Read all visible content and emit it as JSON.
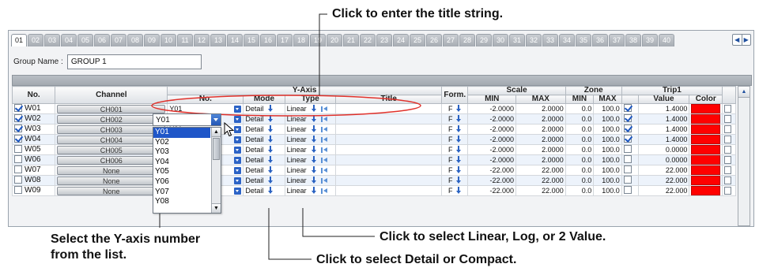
{
  "callouts": {
    "title": "Click to enter the title string.",
    "yaxis": [
      "Select the Y-axis number",
      "from the list."
    ],
    "type": "Click to select Linear, Log, or 2 Value.",
    "mode": "Click to select Detail or Compact."
  },
  "tabs": [
    "01",
    "02",
    "03",
    "04",
    "05",
    "06",
    "07",
    "08",
    "09",
    "10",
    "11",
    "12",
    "13",
    "14",
    "15",
    "16",
    "17",
    "18",
    "19",
    "20",
    "21",
    "22",
    "23",
    "24",
    "25",
    "26",
    "27",
    "28",
    "29",
    "30",
    "31",
    "32",
    "33",
    "34",
    "35",
    "36",
    "37",
    "38",
    "39",
    "40"
  ],
  "tab_nav": {
    "prev": "◀",
    "next": "▶"
  },
  "group": {
    "label": "Group Name :",
    "value": "GROUP 1"
  },
  "headers": {
    "no": "No.",
    "channel": "Channel",
    "yaxis": "Y-Axis",
    "ya_no": "No.",
    "mode": "Mode",
    "type": "Type",
    "title": "Title",
    "form": "Form.",
    "scale": "Scale",
    "min": "MIN",
    "max": "MAX",
    "zone": "Zone",
    "trip": "Trip1",
    "value": "Value",
    "color": "Color"
  },
  "rows": [
    {
      "no": "W01",
      "checked": true,
      "channel": "CH001",
      "y": "Y01",
      "mode": "Detail",
      "type": "Linear",
      "form": "F",
      "min": "-2.0000",
      "max": "2.0000",
      "zmin": "0.0",
      "zmax": "100.0",
      "trip_on": true,
      "trip": "1.4000"
    },
    {
      "no": "W02",
      "checked": true,
      "channel": "CH002",
      "y": "Y01",
      "mode": "Detail",
      "type": "Linear",
      "form": "F",
      "min": "-2.0000",
      "max": "2.0000",
      "zmin": "0.0",
      "zmax": "100.0",
      "trip_on": true,
      "trip": "1.4000"
    },
    {
      "no": "W03",
      "checked": true,
      "channel": "CH003",
      "y": "Y01",
      "mode": "Detail",
      "type": "Linear",
      "form": "F",
      "min": "-2.0000",
      "max": "2.0000",
      "zmin": "0.0",
      "zmax": "100.0",
      "trip_on": true,
      "trip": "1.4000"
    },
    {
      "no": "W04",
      "checked": true,
      "channel": "CH004",
      "y": "Y01",
      "mode": "Detail",
      "type": "Linear",
      "form": "F",
      "min": "-2.0000",
      "max": "2.0000",
      "zmin": "0.0",
      "zmax": "100.0",
      "trip_on": true,
      "trip": "1.4000"
    },
    {
      "no": "W05",
      "checked": false,
      "channel": "CH005",
      "y": "Y01",
      "mode": "Detail",
      "type": "Linear",
      "form": "F",
      "min": "-2.0000",
      "max": "2.0000",
      "zmin": "0.0",
      "zmax": "100.0",
      "trip_on": false,
      "trip": "0.0000"
    },
    {
      "no": "W06",
      "checked": false,
      "channel": "CH006",
      "y": "Y01",
      "mode": "Detail",
      "type": "Linear",
      "form": "F",
      "min": "-2.0000",
      "max": "2.0000",
      "zmin": "0.0",
      "zmax": "100.0",
      "trip_on": false,
      "trip": "0.0000"
    },
    {
      "no": "W07",
      "checked": false,
      "channel": "None",
      "y": "Y01",
      "mode": "Detail",
      "type": "Linear",
      "form": "F",
      "min": "-22.000",
      "max": "22.000",
      "zmin": "0.0",
      "zmax": "100.0",
      "trip_on": false,
      "trip": "22.000"
    },
    {
      "no": "W08",
      "checked": false,
      "channel": "None",
      "y": "Y01",
      "mode": "Detail",
      "type": "Linear",
      "form": "F",
      "min": "-22.000",
      "max": "22.000",
      "zmin": "0.0",
      "zmax": "100.0",
      "trip_on": false,
      "trip": "22.000"
    },
    {
      "no": "W09",
      "checked": false,
      "channel": "None",
      "y": "Y01",
      "mode": "Detail",
      "type": "Linear",
      "form": "F",
      "min": "-22.000",
      "max": "22.000",
      "zmin": "0.0",
      "zmax": "100.0",
      "trip_on": false,
      "trip": "22.000"
    }
  ],
  "dropdown": {
    "current": "Y01",
    "options": [
      "Y01",
      "Y02",
      "Y03",
      "Y04",
      "Y05",
      "Y06",
      "Y07",
      "Y08"
    ],
    "selected": "Y01"
  },
  "icons": {
    "select": "selection-arrow-icon",
    "title_edit": "title-edit-icon",
    "cursor": "mouse-pointer-icon"
  },
  "colors": {
    "trip_color": "#ff0000",
    "ellipse": "#e0312b",
    "selection": "#1f56c8"
  }
}
